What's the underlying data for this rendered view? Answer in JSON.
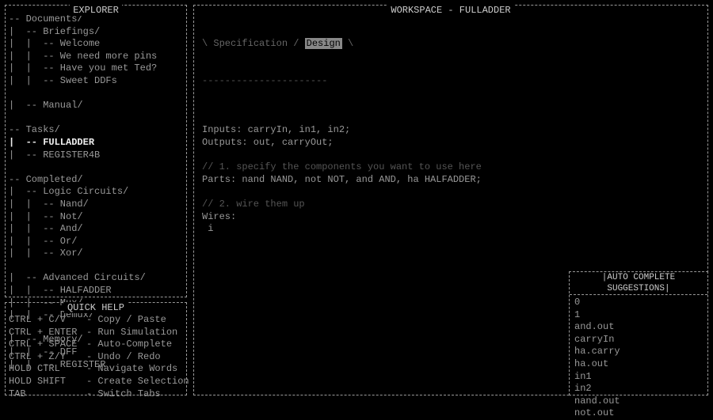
{
  "explorer": {
    "title": "EXPLORER",
    "tree": [
      {
        "text": "-- Documents/",
        "indent": 0,
        "bright": false
      },
      {
        "text": "-- Briefings/",
        "indent": 1,
        "bright": false
      },
      {
        "text": "-- Welcome",
        "indent": 2,
        "bright": false
      },
      {
        "text": "-- We need more pins",
        "indent": 2,
        "bright": false
      },
      {
        "text": "-- Have you met Ted?",
        "indent": 2,
        "bright": false
      },
      {
        "text": "-- Sweet DDFs",
        "indent": 2,
        "bright": false
      },
      {
        "text": "",
        "indent": 0,
        "bright": false
      },
      {
        "text": "-- Manual/",
        "indent": 1,
        "bright": false
      },
      {
        "text": "",
        "indent": 0,
        "bright": false
      },
      {
        "text": "-- Tasks/",
        "indent": 0,
        "bright": false
      },
      {
        "text": "-- FULLADDER",
        "indent": 1,
        "bright": true
      },
      {
        "text": "-- REGISTER4B",
        "indent": 1,
        "bright": false
      },
      {
        "text": "",
        "indent": 0,
        "bright": false
      },
      {
        "text": "-- Completed/",
        "indent": 0,
        "bright": false
      },
      {
        "text": "-- Logic Circuits/",
        "indent": 1,
        "bright": false
      },
      {
        "text": "-- Nand/",
        "indent": 2,
        "bright": false
      },
      {
        "text": "-- Not/",
        "indent": 2,
        "bright": false
      },
      {
        "text": "-- And/",
        "indent": 2,
        "bright": false
      },
      {
        "text": "-- Or/",
        "indent": 2,
        "bright": false
      },
      {
        "text": "-- Xor/",
        "indent": 2,
        "bright": false
      },
      {
        "text": "",
        "indent": 0,
        "bright": false
      },
      {
        "text": "-- Advanced Circuits/",
        "indent": 1,
        "bright": false
      },
      {
        "text": "-- HALFADDER",
        "indent": 2,
        "bright": false
      },
      {
        "text": "-- Mux/",
        "indent": 2,
        "bright": false
      },
      {
        "text": "-- Demux/",
        "indent": 2,
        "bright": false
      },
      {
        "text": "",
        "indent": 0,
        "bright": false
      },
      {
        "text": "-- Memory/",
        "indent": 1,
        "bright": false
      },
      {
        "text": "-- DFF",
        "indent": 2,
        "bright": false
      },
      {
        "text": "-- REGISTER",
        "indent": 2,
        "bright": false
      }
    ]
  },
  "quickhelp": {
    "title": "QUICK HELP",
    "rows": [
      {
        "key": "CTRL + C/V",
        "desc": "- Copy / Paste"
      },
      {
        "key": "CTRL + ENTER",
        "desc": "- Run Simulation"
      },
      {
        "key": "CTRL + SPACE",
        "desc": "- Auto-Complete"
      },
      {
        "key": "CTRL + Z/Y",
        "desc": "- Undo / Redo"
      },
      {
        "key": "HOLD CTRL",
        "desc": "- Navigate Words"
      },
      {
        "key": "HOLD SHIFT",
        "desc": "- Create Selection"
      },
      {
        "key": "TAB",
        "desc": "- Switch Tabs"
      }
    ]
  },
  "workspace": {
    "title": "WORKSPACE - FULLADDER",
    "tabs": {
      "prefix": "\\ ",
      "inactive": "Specification",
      "sep": " / ",
      "active": "Design",
      "suffix": " \\"
    },
    "ruler": "----------------------",
    "lines": [
      {
        "text": "",
        "dim": false
      },
      {
        "text": "Inputs: carryIn, in1, in2;",
        "dim": false
      },
      {
        "text": "Outputs: out, carryOut;",
        "dim": false
      },
      {
        "text": "",
        "dim": false
      },
      {
        "text": "// 1. specify the components you want to use here",
        "dim": true
      },
      {
        "text": "Parts: nand NAND, not NOT, and AND, ha HALFADDER;",
        "dim": false
      },
      {
        "text": "",
        "dim": false
      },
      {
        "text": "// 2. wire them up",
        "dim": true
      },
      {
        "text": "Wires:",
        "dim": false
      },
      {
        "text": " i",
        "dim": false,
        "cursor": true
      }
    ]
  },
  "autocomplete": {
    "title": "AUTO COMPLETE SUGGESTIONS",
    "items": [
      "0",
      "1",
      "and.out",
      "carryIn",
      "ha.carry",
      "ha.out",
      "in1",
      "in2",
      "nand.out",
      "not.out"
    ]
  }
}
